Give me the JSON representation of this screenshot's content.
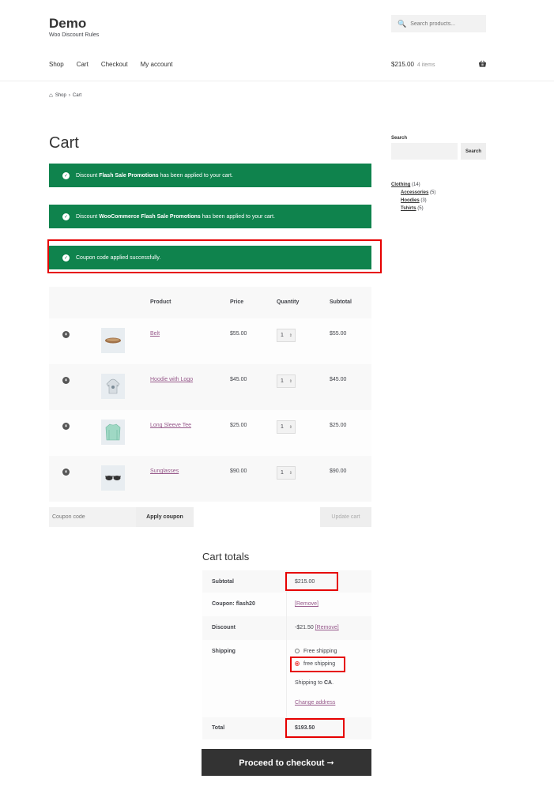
{
  "header": {
    "site_title": "Demo",
    "site_description": "Woo Discount Rules",
    "search_placeholder": "Search products...",
    "nav": [
      "Shop",
      "Cart",
      "Checkout",
      "My account"
    ],
    "cart_amount": "$215.00",
    "cart_items": "4 items"
  },
  "breadcrumb": {
    "shop": "Shop",
    "sep": "›",
    "current": "Cart"
  },
  "page_title": "Cart",
  "notices": [
    {
      "pre": "Discount ",
      "bold": "Flash Sale Promotions",
      "post": " has been applied to your cart."
    },
    {
      "pre": "Discount ",
      "bold": "WooCommerce Flash Sale Promotions",
      "post": " has been applied to your cart."
    },
    {
      "pre": "Coupon code applied successfully.",
      "bold": "",
      "post": ""
    }
  ],
  "table": {
    "headers": {
      "product": "Product",
      "price": "Price",
      "quantity": "Quantity",
      "subtotal": "Subtotal"
    },
    "rows": [
      {
        "name": "Belt",
        "price": "$55.00",
        "qty": "1",
        "subtotal": "$55.00"
      },
      {
        "name": "Hoodie with Logo",
        "price": "$45.00",
        "qty": "1",
        "subtotal": "$45.00"
      },
      {
        "name": "Long Sleeve Tee",
        "price": "$25.00",
        "qty": "1",
        "subtotal": "$25.00"
      },
      {
        "name": "Sunglasses",
        "price": "$90.00",
        "qty": "1",
        "subtotal": "$90.00"
      }
    ]
  },
  "coupon": {
    "placeholder": "Coupon code",
    "apply_label": "Apply coupon",
    "update_label": "Update cart"
  },
  "totals": {
    "title": "Cart totals",
    "subtotal_label": "Subtotal",
    "subtotal_value": "$215.00",
    "coupon_label": "Coupon: flash20",
    "coupon_remove": "[Remove]",
    "discount_label": "Discount",
    "discount_value": "-$21.50",
    "discount_remove": "[Remove]",
    "shipping_label": "Shipping",
    "shipping_option_1": "Free shipping",
    "shipping_option_2": "free shipping",
    "shipping_to_pre": "Shipping to ",
    "shipping_to_state": "CA",
    "shipping_to_post": ".",
    "change_address": "Change address",
    "total_label": "Total",
    "total_value": "$193.50",
    "proceed_label": "Proceed to checkout ➞"
  },
  "sidebar": {
    "search_title": "Search",
    "search_button": "Search",
    "categories": [
      {
        "name": "Clothing",
        "count": "(14)",
        "level": 0
      },
      {
        "name": "Accessories",
        "count": "(5)",
        "level": 1
      },
      {
        "name": "Hoodies",
        "count": "(3)",
        "level": 1
      },
      {
        "name": "Tshirts",
        "count": "(5)",
        "level": 1
      }
    ]
  }
}
